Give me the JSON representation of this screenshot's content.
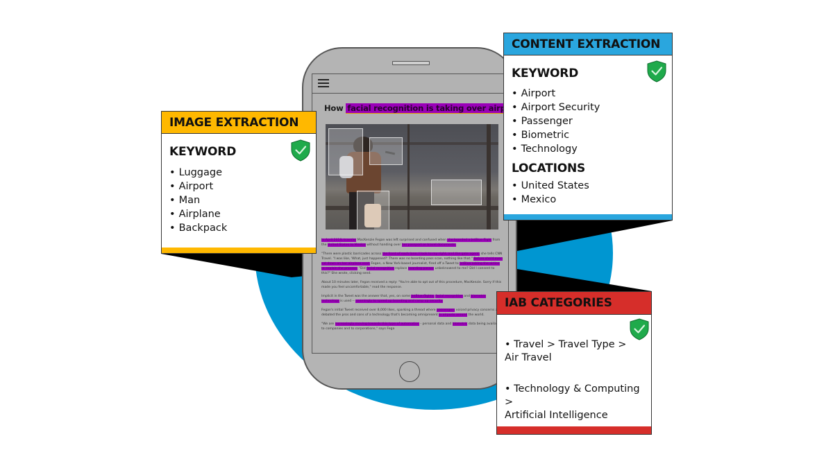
{
  "colors": {
    "circle": "#0096d1",
    "connector": "#000000",
    "image_card_accent": "#ffb800",
    "content_card_accent": "#2aa6de",
    "iab_card_accent": "#d62e2a",
    "highlight": "#9a00b8",
    "shield": "#1faa4b",
    "phone_body": "#b4b4b4"
  },
  "phone": {
    "menu_icon": "hamburger-icon",
    "article": {
      "headline_prefix": "How ",
      "headline_highlight": "facial recognition is taking over airports",
      "paragraphs": [
        [
          {
            "t": "In April 2019, traveler",
            "h": true
          },
          {
            "t": " MacKenzie Fegan was left surprised and confused when ",
            "h": false
          },
          {
            "t": "she boarded a JetBlue flight",
            "h": true
          },
          {
            "t": " from the ",
            "h": false
          },
          {
            "t": "United States to Mexico",
            "h": true
          },
          {
            "t": " without handing over ",
            "h": false
          },
          {
            "t": "her passport or travel documents.",
            "h": true
          }
        ],
        [
          {
            "t": "\"There were plastic barricades across ",
            "h": false
          },
          {
            "t": "the front of each lane, I look to my right, and the gate agent,",
            "h": true
          },
          {
            "t": " she tells CNN Travel. \"I was like, 'What, just happened?' There was no boarding pass scan, nothing like that.\" ",
            "h": false
          },
          {
            "t": "Before she'd even sat down on her airplane seat,",
            "h": true
          },
          {
            "t": " Fegan, a New York-based journalist, fired off a Tweet to ",
            "h": false
          },
          {
            "t": "JetBlue asking the airline to explain the process.",
            "h": true
          },
          {
            "t": " \"Did ",
            "h": false
          },
          {
            "t": "facial recognition",
            "h": true
          },
          {
            "t": " replace ",
            "h": false
          },
          {
            "t": "boarding passes",
            "h": true
          },
          {
            "t": " unbeknownst to me? Did I consent to this?\" She wrote, clicking send.",
            "h": false
          }
        ],
        [
          {
            "t": "About 10 minutes later, Fegan received a reply: \"You're able to opt out of this procedure, MacKenzie. Sorry if this made you feel uncomfortable,\" read the response.",
            "h": false
          }
        ],
        [
          {
            "t": "Implicit in the Tweet was the answer that, yes, on some ",
            "h": false
          },
          {
            "t": "JetBlue flights,",
            "h": true
          },
          {
            "t": " ",
            "h": false
          },
          {
            "t": "facial recognition",
            "h": true
          },
          {
            "t": " and ",
            "h": false
          },
          {
            "t": "biometric technology",
            "h": true
          },
          {
            "t": " is used -- ",
            "h": false
          },
          {
            "t": "seemingly to speed up boarding and ramp up security.",
            "h": true
          }
        ],
        [
          {
            "t": "Fegan's initial Tweet received over 8,000 likes, sparking a thread where ",
            "h": false
          },
          {
            "t": "passengers",
            "h": true
          },
          {
            "t": " voiced privacy concerns and debated the pros and cons of a technology that's becoming omnipresent ",
            "h": false
          },
          {
            "t": "in airports around",
            "h": true
          },
          {
            "t": " the world.",
            "h": false
          }
        ],
        [
          {
            "t": "\"We are ",
            "h": false
          },
          {
            "t": "increasingly moving towards this type of automation",
            "h": true
          },
          {
            "t": " - personal data and ",
            "h": false
          },
          {
            "t": "biometric",
            "h": true
          },
          {
            "t": " data being available to companies and to corporations,\" says Fega",
            "h": false
          }
        ]
      ]
    }
  },
  "image_extraction": {
    "title": "IMAGE EXTRACTION",
    "section": "KEYWORD",
    "icon": "shield-check-icon",
    "keywords": [
      "Luggage",
      "Airport",
      "Man",
      "Airplane",
      "Backpack"
    ]
  },
  "content_extraction": {
    "title": "CONTENT EXTRACTION",
    "keyword_section": "KEYWORD",
    "icon": "shield-check-icon",
    "keywords": [
      "Airport",
      "Airport Security",
      "Passenger",
      "Biometric",
      "Technology"
    ],
    "locations_section": "LOCATIONS",
    "locations": [
      "United States",
      "Mexico"
    ]
  },
  "iab_categories": {
    "title": "IAB CATEGORIES",
    "icon": "shield-check-icon",
    "items": [
      {
        "line1": "• Travel > Travel Type >",
        "line2": "Air Travel"
      },
      {
        "line1": "• Technology & Computing >",
        "line2": "Artificial Intelligence"
      }
    ]
  }
}
